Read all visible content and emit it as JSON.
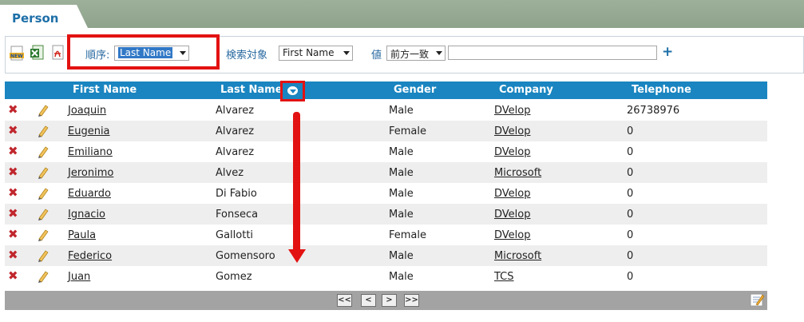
{
  "tab": {
    "title": "Person"
  },
  "toolbar": {
    "order_label": "順序:",
    "order_value": "Last Name",
    "search_target_label": "検索対象",
    "search_target_value": "First Name",
    "value_label": "値",
    "match_value": "前方一致",
    "value_input": "",
    "add_symbol": "+"
  },
  "columns": [
    "First Name",
    "Last Name",
    "Gender",
    "Company",
    "Telephone"
  ],
  "rows": [
    {
      "first_name": "Joaquin",
      "last_name": "Alvarez",
      "gender": "Male",
      "company": "DVelop",
      "telephone": "26738976"
    },
    {
      "first_name": "Eugenia",
      "last_name": "Alvarez",
      "gender": "Female",
      "company": "DVelop",
      "telephone": "0"
    },
    {
      "first_name": "Emiliano",
      "last_name": "Alvarez",
      "gender": "Male",
      "company": "DVelop",
      "telephone": "0"
    },
    {
      "first_name": "Jeronimo",
      "last_name": "Alvez",
      "gender": "Male",
      "company": "Microsoft",
      "telephone": "0"
    },
    {
      "first_name": "Eduardo",
      "last_name": "Di Fabio",
      "gender": "Male",
      "company": "DVelop",
      "telephone": "0"
    },
    {
      "first_name": "Ignacio",
      "last_name": "Fonseca",
      "gender": "Male",
      "company": "DVelop",
      "telephone": "0"
    },
    {
      "first_name": "Paula",
      "last_name": "Gallotti",
      "gender": "Female",
      "company": "DVelop",
      "telephone": "0"
    },
    {
      "first_name": "Federico",
      "last_name": "Gomensoro",
      "gender": "Male",
      "company": "Microsoft",
      "telephone": "0"
    },
    {
      "first_name": "Juan",
      "last_name": "Gomez",
      "gender": "Male",
      "company": "TCS",
      "telephone": "0"
    }
  ],
  "row_icons": {
    "delete": "delete-icon",
    "edit": "edit-icon"
  },
  "pager": {
    "first": "<<",
    "prev": "<",
    "next": ">",
    "last": ">>"
  },
  "colors": {
    "accent": "#1a85c0",
    "annotation": "#e31212",
    "tab_bar": "#9db09a"
  }
}
